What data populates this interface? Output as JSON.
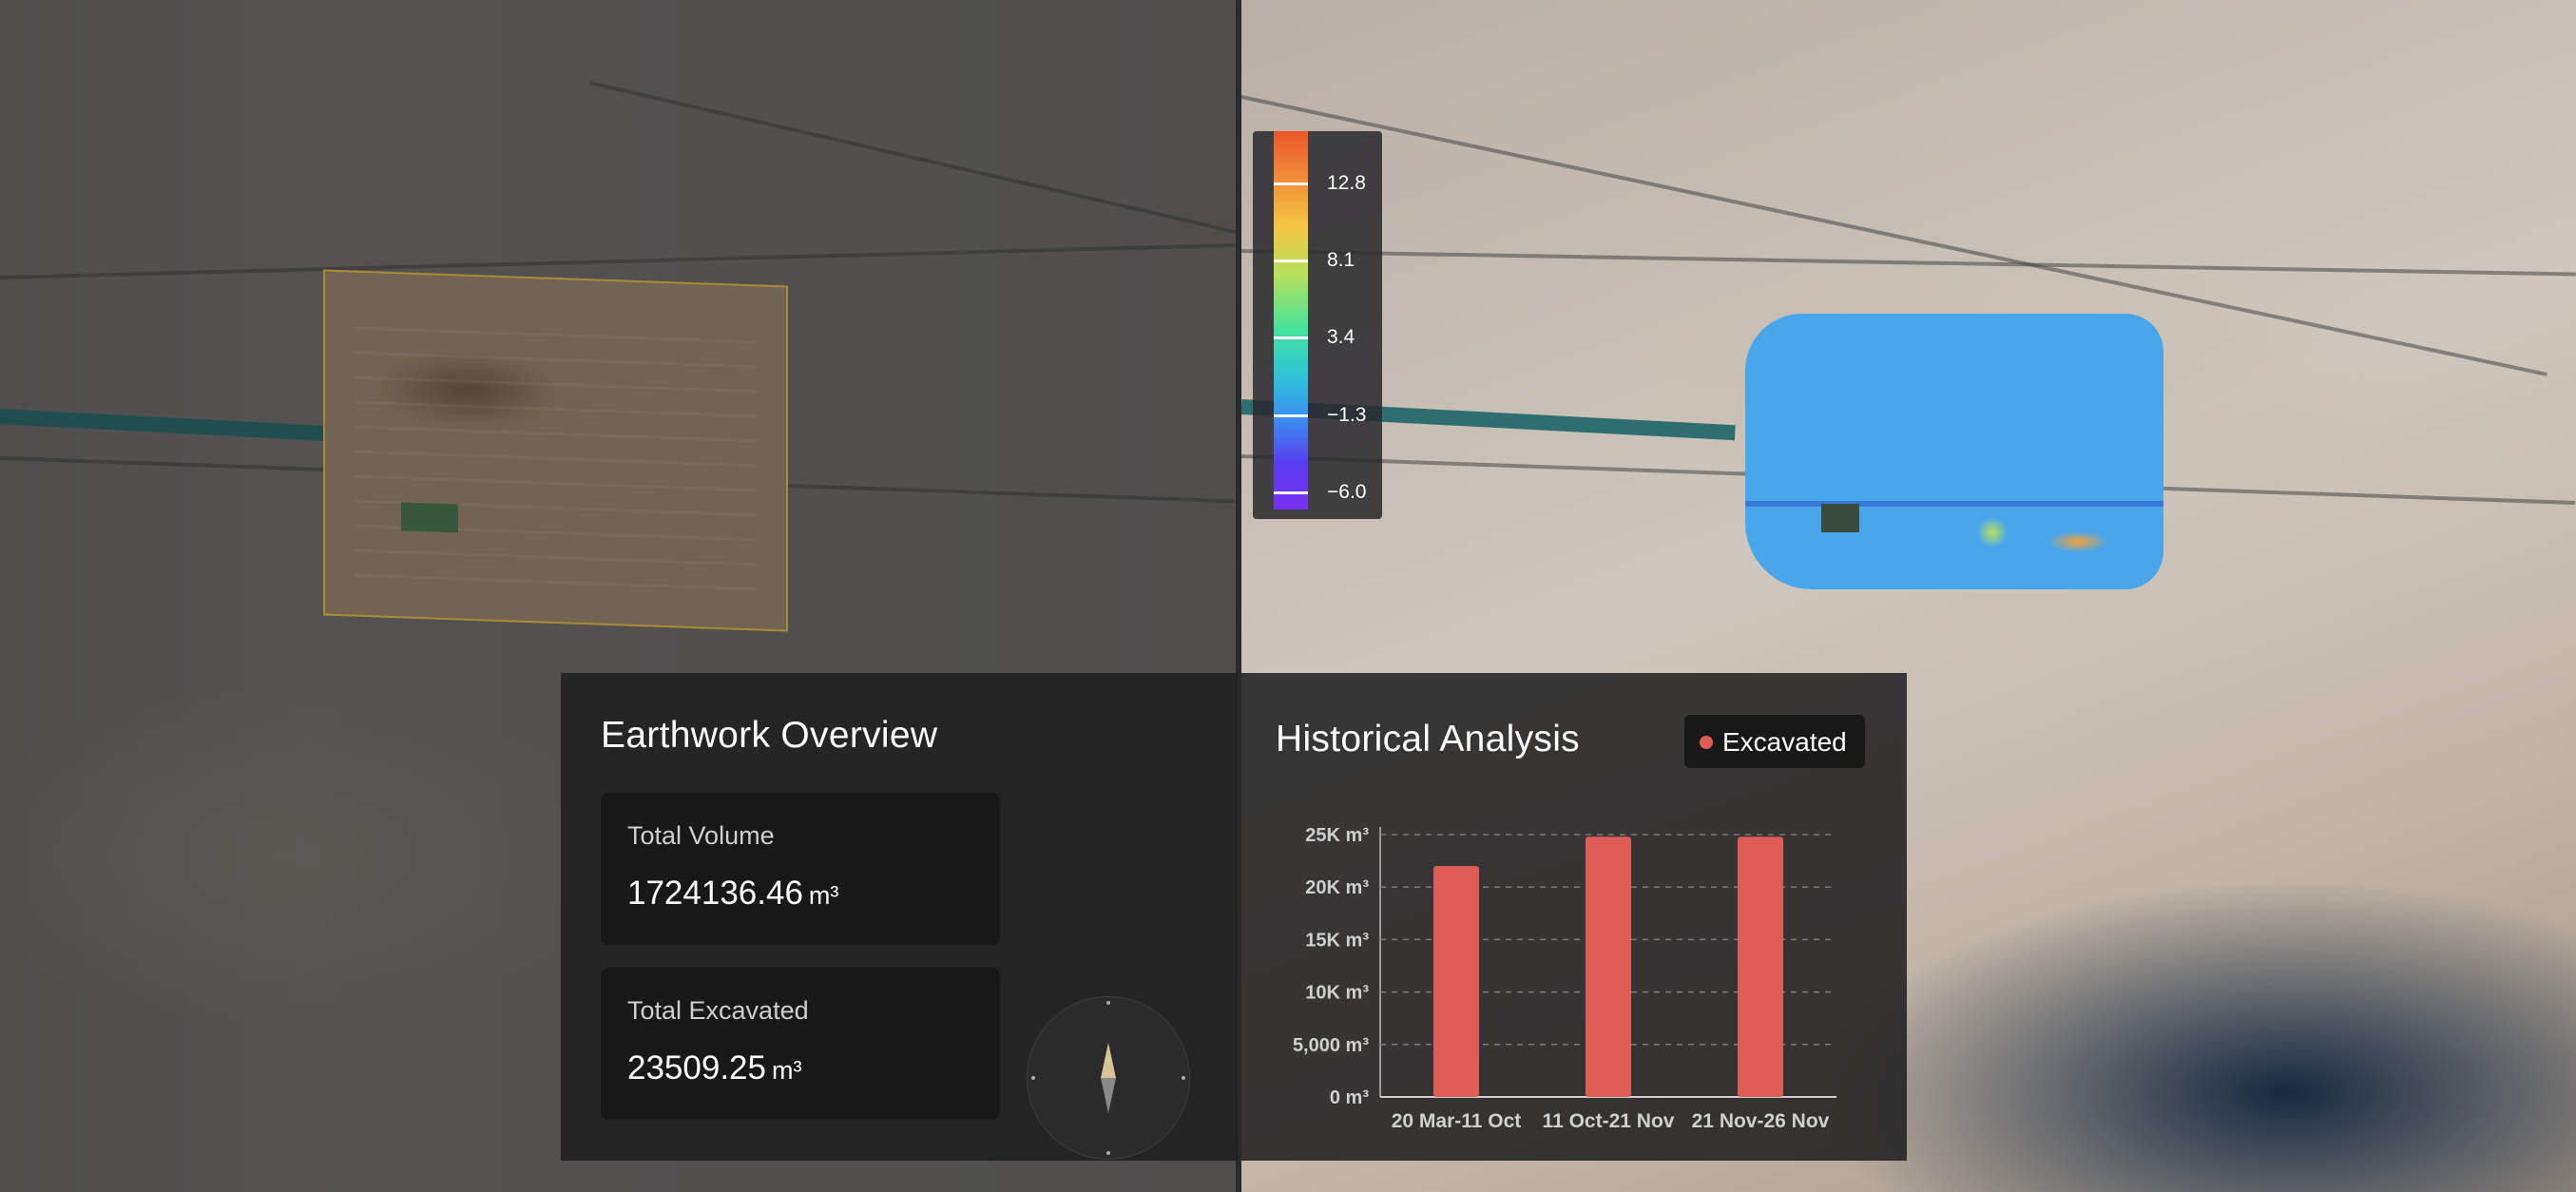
{
  "colorbar": {
    "ticks": [
      "12.8",
      "8.1",
      "3.4",
      "−1.3",
      "−6.0"
    ]
  },
  "overview": {
    "title": "Earthwork Overview",
    "total_volume": {
      "label": "Total Volume",
      "value": "1724136.46",
      "unit": "m³"
    },
    "total_excavated": {
      "label": "Total Excavated",
      "value": "23509.25",
      "unit": "m³"
    }
  },
  "analysis": {
    "title": "Historical Analysis",
    "legend_label": "Excavated",
    "legend_color": "#e05c57"
  },
  "chart_data": {
    "type": "bar",
    "categories": [
      "20 Mar-11 Oct",
      "11 Oct-21 Nov",
      "21 Nov-26 Nov"
    ],
    "series": [
      {
        "name": "Excavated",
        "values": [
          22000,
          24800,
          24800
        ],
        "color": "#e05c57"
      }
    ],
    "ylim": [
      0,
      25000
    ],
    "yticks": [
      {
        "value": 0,
        "label": "0 m³"
      },
      {
        "value": 5000,
        "label": "5,000 m³"
      },
      {
        "value": 10000,
        "label": "10K m³"
      },
      {
        "value": 15000,
        "label": "15K m³"
      },
      {
        "value": 20000,
        "label": "20K m³"
      },
      {
        "value": 25000,
        "label": "25K m³"
      }
    ],
    "grid": true
  }
}
